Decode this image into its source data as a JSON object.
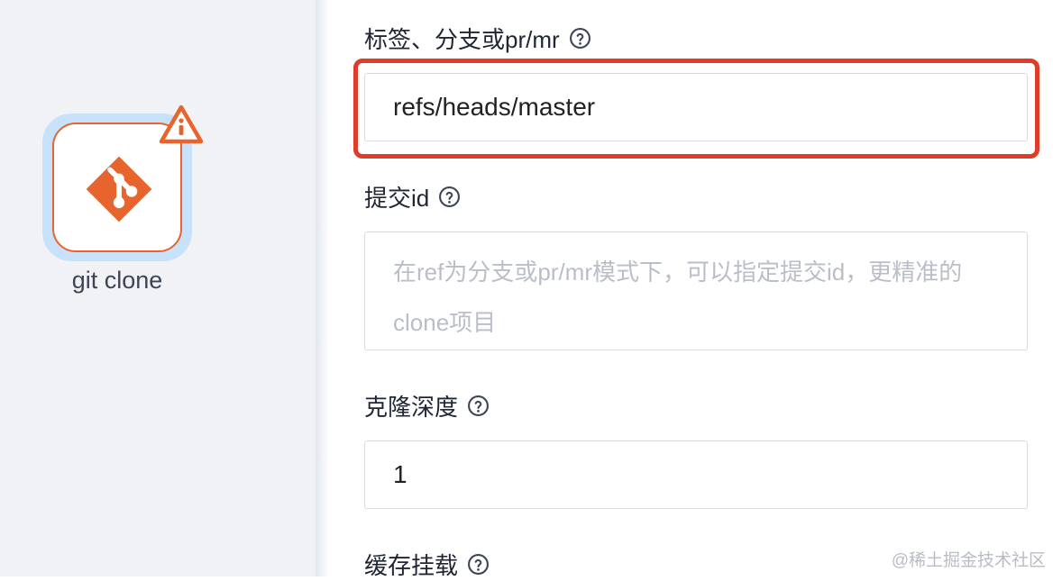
{
  "canvas": {
    "node": {
      "label": "git clone",
      "icon": "git-logo-icon",
      "status_icon": "warning-icon",
      "accent": "#e8642e"
    }
  },
  "form": {
    "ref_field": {
      "label": "标签、分支或pr/mr",
      "value": "refs/heads/master"
    },
    "commit_field": {
      "label": "提交id",
      "placeholder": "在ref为分支或pr/mr模式下，可以指定提交id，更精准的clone项目"
    },
    "depth_field": {
      "label": "克隆深度",
      "value": "1"
    },
    "cache_field": {
      "label": "缓存挂载"
    }
  },
  "watermark": "@稀土掘金技术社区",
  "colors": {
    "highlight": "#e03c2a",
    "selection": "#c9e2fb"
  }
}
